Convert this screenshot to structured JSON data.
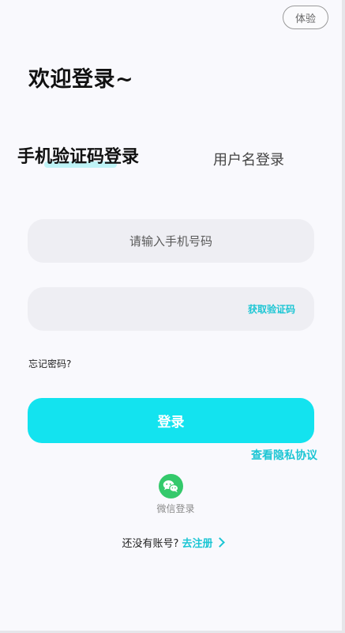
{
  "header": {
    "trial_label": "体验"
  },
  "welcome_title": "欢迎登录~",
  "tabs": [
    {
      "label": "手机验证码登录",
      "active": true
    },
    {
      "label": "用户名登录",
      "active": false
    }
  ],
  "form": {
    "phone_placeholder": "请输入手机号码",
    "phone_value": "",
    "code_value": "",
    "get_code_label": "获取验证码",
    "forgot_label": "忘记密码?",
    "login_label": "登录",
    "privacy_label": "查看隐私协议"
  },
  "social": {
    "wechat_label": "微信登录",
    "wechat_icon": "wechat-icon"
  },
  "register": {
    "prompt": "还没有账号?",
    "link_label": "去注册"
  },
  "colors": {
    "accent": "#13e3ef",
    "accent_text": "#1dc6d4",
    "wechat": "#34c96b",
    "field_bg": "#eeeef3"
  }
}
